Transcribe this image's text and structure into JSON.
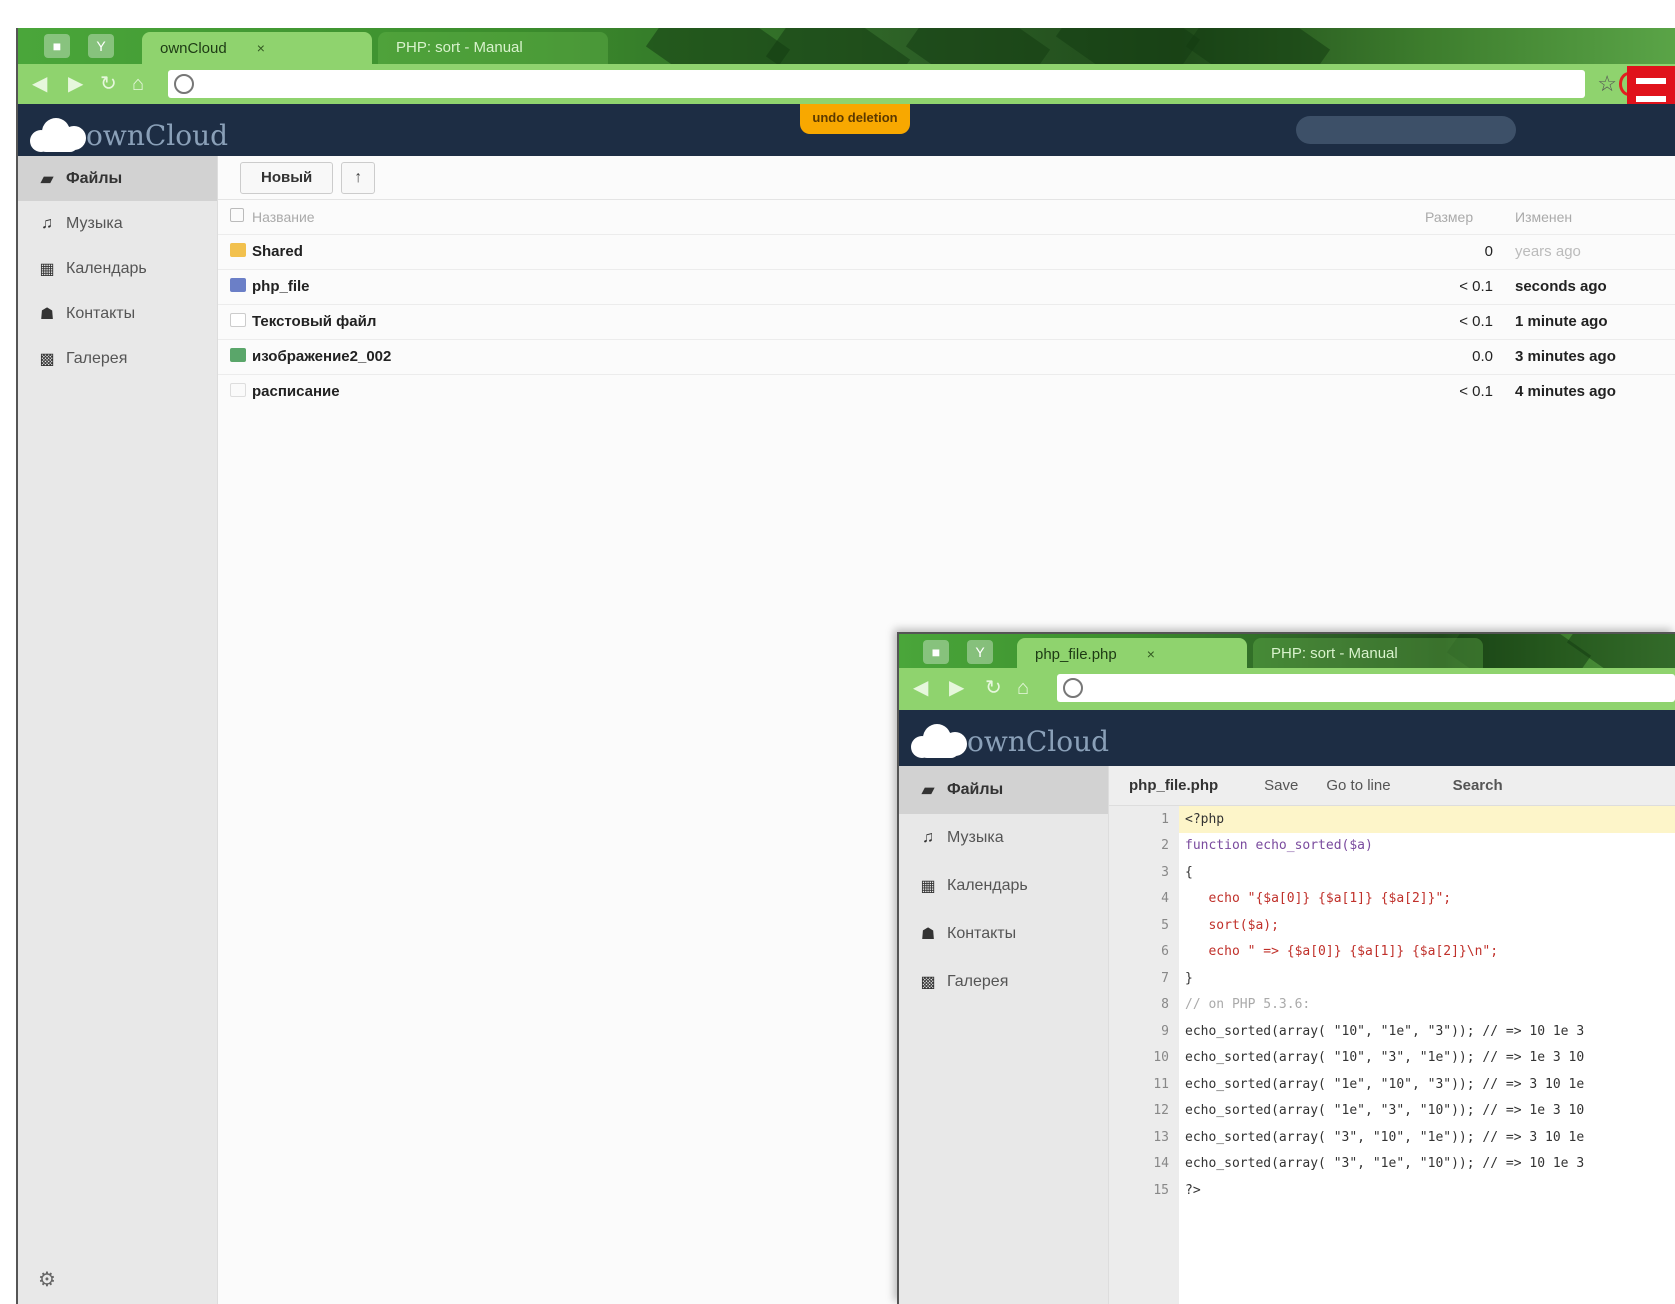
{
  "main": {
    "tabs": [
      {
        "title": "ownCloud",
        "active": true
      },
      {
        "title": "PHP: sort - Manual",
        "active": false
      }
    ],
    "logo_text": "ownCloud",
    "undo_label": "undo deletion",
    "sidebar": [
      {
        "label": "Файлы",
        "icon": "folder-icon",
        "active": true
      },
      {
        "label": "Музыка",
        "icon": "music-icon",
        "active": false
      },
      {
        "label": "Календарь",
        "icon": "calendar-icon",
        "active": false
      },
      {
        "label": "Контакты",
        "icon": "contacts-icon",
        "active": false
      },
      {
        "label": "Галерея",
        "icon": "gallery-icon",
        "active": false
      }
    ],
    "new_button": "Новый",
    "upload_symbol": "↑",
    "columns": {
      "name": "Название",
      "size": "Размер",
      "modified": "Изменен"
    },
    "files": [
      {
        "name": "Shared",
        "type": "folder",
        "size": "0",
        "modified": "years ago"
      },
      {
        "name": "php_file",
        "type": "code",
        "size": "< 0.1",
        "modified": "seconds ago"
      },
      {
        "name": "Текстовый файл",
        "type": "text",
        "size": "< 0.1",
        "modified": "1 minute ago"
      },
      {
        "name": "изображение2_002",
        "type": "image",
        "size": "0.0",
        "modified": "3 minutes ago"
      },
      {
        "name": "расписание",
        "type": "doc",
        "size": "< 0.1",
        "modified": "4 minutes ago"
      }
    ]
  },
  "editor_window": {
    "tabs": [
      {
        "title": "php_file.php",
        "active": true
      },
      {
        "title": "PHP: sort - Manual",
        "active": false
      }
    ],
    "logo_text": "ownCloud",
    "sidebar": [
      {
        "label": "Файлы",
        "icon": "folder-icon",
        "active": true
      },
      {
        "label": "Музыка",
        "icon": "music-icon",
        "active": false
      },
      {
        "label": "Календарь",
        "icon": "calendar-icon",
        "active": false
      },
      {
        "label": "Контакты",
        "icon": "contacts-icon",
        "active": false
      },
      {
        "label": "Галерея",
        "icon": "gallery-icon",
        "active": false
      }
    ],
    "filename": "php_file.php",
    "save_label": "Save",
    "goto_label": "Go to line",
    "search_label": "Search",
    "code_lines": [
      {
        "n": "1",
        "text": "<?php",
        "hl": true
      },
      {
        "n": "2",
        "text": "function echo_sorted($a)",
        "hl": false
      },
      {
        "n": "3",
        "text": "{",
        "hl": false
      },
      {
        "n": "4",
        "text": "   echo \"{$a[0]} {$a[1]} {$a[2]}\";",
        "hl": false
      },
      {
        "n": "5",
        "text": "   sort($a);",
        "hl": false
      },
      {
        "n": "6",
        "text": "   echo \" => {$a[0]} {$a[1]} {$a[2]}\\n\";",
        "hl": false
      },
      {
        "n": "7",
        "text": "}",
        "hl": false
      },
      {
        "n": "8",
        "text": "// on PHP 5.3.6:",
        "hl": false
      },
      {
        "n": "9",
        "text": "echo_sorted(array( \"10\", \"1e\", \"3\")); // => 10 1e 3",
        "hl": false
      },
      {
        "n": "10",
        "text": "echo_sorted(array( \"10\", \"3\", \"1e\")); // => 1e 3 10",
        "hl": false
      },
      {
        "n": "11",
        "text": "echo_sorted(array( \"1e\", \"10\", \"3\")); // => 3 10 1e",
        "hl": false
      },
      {
        "n": "12",
        "text": "echo_sorted(array( \"1e\", \"3\", \"10\")); // => 1e 3 10",
        "hl": false
      },
      {
        "n": "13",
        "text": "echo_sorted(array( \"3\", \"10\", \"1e\")); // => 3 10 1e",
        "hl": false
      },
      {
        "n": "14",
        "text": "echo_sorted(array( \"3\", \"1e\", \"10\")); // => 10 1e 3",
        "hl": false
      },
      {
        "n": "15",
        "text": "?>",
        "hl": false
      }
    ]
  },
  "colors": {
    "header": "#1d2d44",
    "theme_green": "#8fd36e",
    "undo": "#f8a800",
    "accent_red": "#e0121b"
  }
}
